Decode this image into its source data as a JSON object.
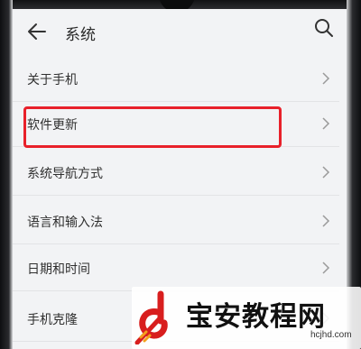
{
  "header": {
    "title": "系统",
    "back_icon": "back-arrow-icon",
    "search_icon": "search-icon"
  },
  "menu": {
    "items": [
      {
        "label": "关于手机"
      },
      {
        "label": "软件更新",
        "highlighted": true
      },
      {
        "label": "系统导航方式"
      },
      {
        "label": "语言和输入法"
      },
      {
        "label": "日期和时间"
      },
      {
        "label": "手机克隆"
      }
    ]
  },
  "highlight_color": "#e8202a",
  "watermark": {
    "text": "宝安教程网",
    "url": "hcjhd.com"
  }
}
